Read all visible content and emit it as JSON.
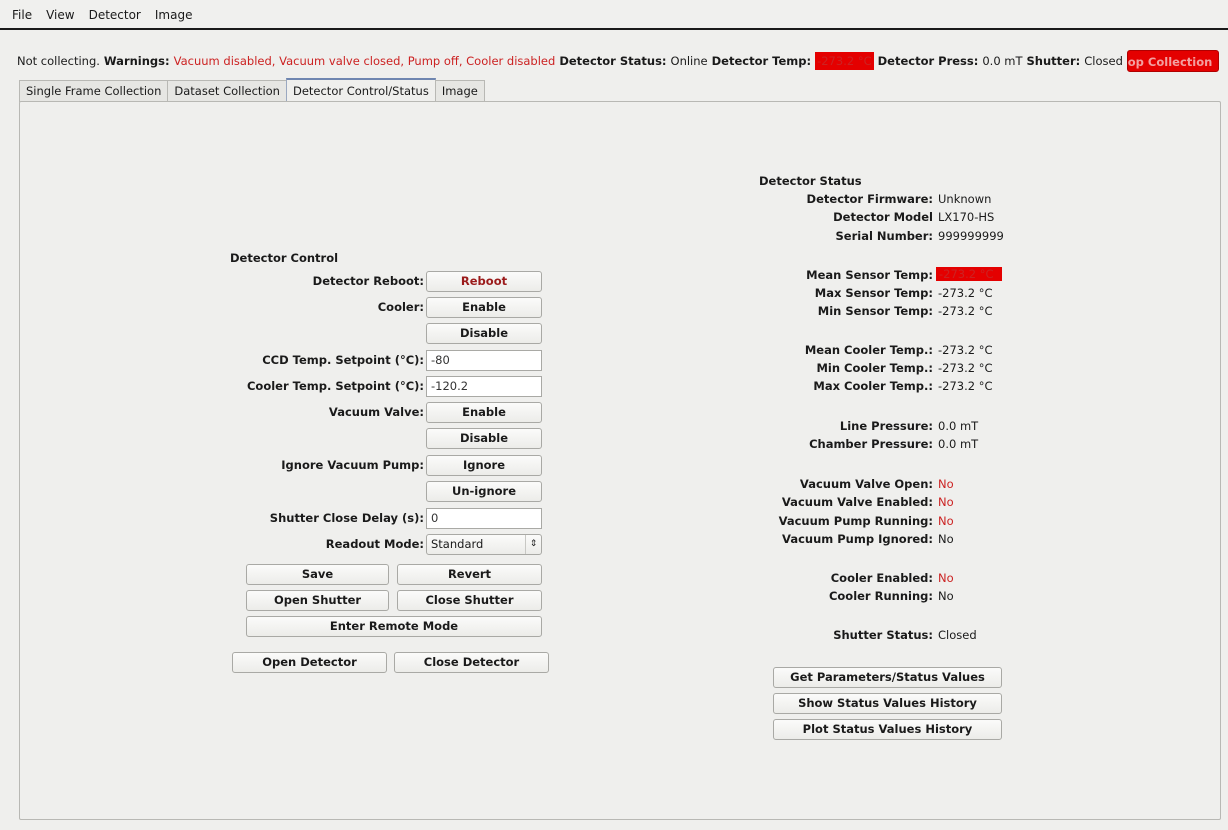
{
  "menu": [
    "File",
    "View",
    "Detector",
    "Image"
  ],
  "status": {
    "collecting": "Not collecting.",
    "warnings_label": "Warnings:",
    "warnings_text": "Vacuum disabled, Vacuum valve closed, Pump off, Cooler disabled",
    "detector_status_label": "Detector Status:",
    "detector_status_value": "Online",
    "detector_temp_label": "Detector Temp:",
    "detector_temp_value": "-273.2 °C",
    "detector_press_label": "Detector Press:",
    "detector_press_value": "0.0 mT",
    "shutter_label": "Shutter:",
    "shutter_value": "Closed",
    "stop_button": "Stop Collection"
  },
  "tabs": [
    "Single Frame Collection",
    "Dataset Collection",
    "Detector Control/Status",
    "Image"
  ],
  "control": {
    "title": "Detector Control",
    "reboot_label": "Detector Reboot:",
    "reboot_btn": "Reboot",
    "cooler_label": "Cooler:",
    "cooler_enable": "Enable",
    "cooler_disable": "Disable",
    "ccd_setpoint_label": "CCD Temp. Setpoint (°C):",
    "ccd_setpoint_value": "-80",
    "cooler_setpoint_label": "Cooler Temp. Setpoint (°C):",
    "cooler_setpoint_value": "-120.2",
    "vacuum_valve_label": "Vacuum Valve:",
    "vacuum_enable": "Enable",
    "vacuum_disable": "Disable",
    "ignore_pump_label": "Ignore Vacuum Pump:",
    "ignore_btn": "Ignore",
    "unignore_btn": "Un-ignore",
    "shutter_delay_label": "Shutter Close Delay (s):",
    "shutter_delay_value": "0",
    "readout_label": "Readout Mode:",
    "readout_value": "Standard",
    "save": "Save",
    "revert": "Revert",
    "open_shutter": "Open Shutter",
    "close_shutter": "Close Shutter",
    "remote_mode": "Enter Remote Mode",
    "open_detector": "Open Detector",
    "close_detector": "Close Detector"
  },
  "detector_status": {
    "title": "Detector Status",
    "firmware_label": "Detector Firmware:",
    "firmware_value": "Unknown",
    "model_label": "Detector Model",
    "model_value": "LX170-HS",
    "serial_label": "Serial Number:",
    "serial_value": "999999999",
    "mean_sensor_label": "Mean Sensor Temp:",
    "mean_sensor_value": "-273.2 °C",
    "max_sensor_label": "Max Sensor Temp:",
    "max_sensor_value": "-273.2 °C",
    "min_sensor_label": "Min Sensor Temp:",
    "min_sensor_value": "-273.2 °C",
    "mean_cooler_label": "Mean Cooler Temp.:",
    "mean_cooler_value": "-273.2 °C",
    "min_cooler_label": "Min Cooler Temp.:",
    "min_cooler_value": "-273.2 °C",
    "max_cooler_label": "Max Cooler Temp.:",
    "max_cooler_value": "-273.2 °C",
    "line_pressure_label": "Line Pressure:",
    "line_pressure_value": "0.0 mT",
    "chamber_pressure_label": "Chamber Pressure:",
    "chamber_pressure_value": "0.0 mT",
    "valve_open_label": "Vacuum Valve Open:",
    "valve_open_value": "No",
    "valve_enabled_label": "Vacuum Valve Enabled:",
    "valve_enabled_value": "No",
    "pump_running_label": "Vacuum Pump Running:",
    "pump_running_value": "No",
    "pump_ignored_label": "Vacuum Pump Ignored:",
    "pump_ignored_value": "No",
    "cooler_enabled_label": "Cooler Enabled:",
    "cooler_enabled_value": "No",
    "cooler_running_label": "Cooler Running:",
    "cooler_running_value": "No",
    "shutter_status_label": "Shutter Status:",
    "shutter_status_value": "Closed",
    "get_params_btn": "Get Parameters/Status Values",
    "show_history_btn": "Show Status Values History",
    "plot_history_btn": "Plot Status Values History"
  }
}
